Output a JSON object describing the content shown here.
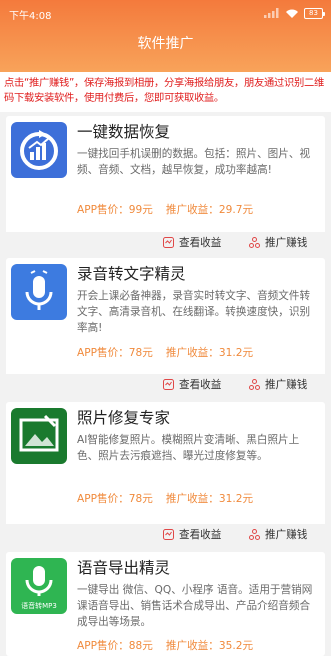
{
  "status_bar": {
    "time": "下午4:08",
    "battery": "83"
  },
  "header": {
    "title": "软件推广"
  },
  "notice": "点击“推广赚钱”，保存海报到相册，分享海报给朋友，朋友通过识别二维码下载安装软件，使用付费后，您即可获取收益。",
  "apps": [
    {
      "name": "一键数据恢复",
      "description": "一键找回手机误删的数据。包括：照片、图片、视频、音频、文档，越早恢复，成功率越高!",
      "price": "APP售价：99元",
      "commission": "推广收益：29.7元",
      "view_label": "查看收益",
      "promote_label": "推广赚钱",
      "icon": "data-recovery-icon",
      "icon_color": "#3d6fd9"
    },
    {
      "name": "录音转文字精灵",
      "description": "开会上课必备神器，录音实时转文字、音频文件转文字、高清录音机、在线翻译。转换速度快，识别率高!",
      "price": "APP售价：78元",
      "commission": "推广收益：31.2元",
      "view_label": "查看收益",
      "promote_label": "推广赚钱",
      "icon": "microphone-icon",
      "icon_color": "#3d7be0"
    },
    {
      "name": "照片修复专家",
      "description": "AI智能修复照片。模糊照片变清晰、黑白照片上色、照片去污痕遮挡、曝光过度修复等。",
      "price": "APP售价：78元",
      "commission": "推广收益：31.2元",
      "view_label": "查看收益",
      "promote_label": "推广赚钱",
      "icon": "photo-repair-icon",
      "icon_color": "#1a7a2e"
    },
    {
      "name": "语音导出精灵",
      "description": "一键导出 微信、QQ、小程序 语音。适用于营销网课语音导出、销售话术合成导出、产品介绍音频合成导出等场景。",
      "price": "APP售价：88元",
      "commission": "推广收益：35.2元",
      "icon": "voice-export-icon",
      "icon_color": "#2fb552",
      "icon_caption": "语音转MP3"
    }
  ]
}
